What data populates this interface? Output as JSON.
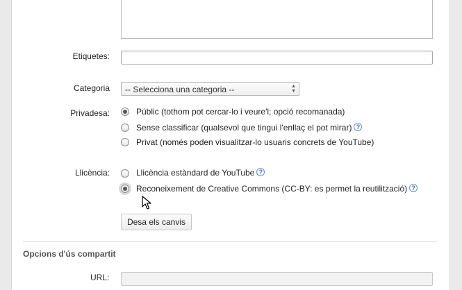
{
  "form": {
    "tags_label": "Etiquetes:",
    "category_label": "Categoria",
    "category_value": "-- Selecciona una categoria --",
    "privacy_label": "Privadesa:",
    "license_label": "Llicència:",
    "help_glyph": "?",
    "privacy_options": [
      {
        "label": "Públic (tothom pot cercar-lo i veure'l; opció recomanada)",
        "selected": true
      },
      {
        "label": "Sense classificar (qualsevol que tingui l'enllaç el pot mirar)",
        "selected": false
      },
      {
        "label": "Privat (només poden visualitzar-lo usuaris concrets de YouTube)",
        "selected": false
      }
    ],
    "license_options": [
      {
        "label": "Llicència estàndard de YouTube",
        "selected": false
      },
      {
        "label": "Reconeixement de Creative Commons (CC-BY: es permet la reutilització)",
        "selected": true
      }
    ],
    "save_button": "Desa els canvis"
  },
  "shared_section": {
    "title": "Opcions d'ús compartit",
    "url_label": "URL:"
  }
}
